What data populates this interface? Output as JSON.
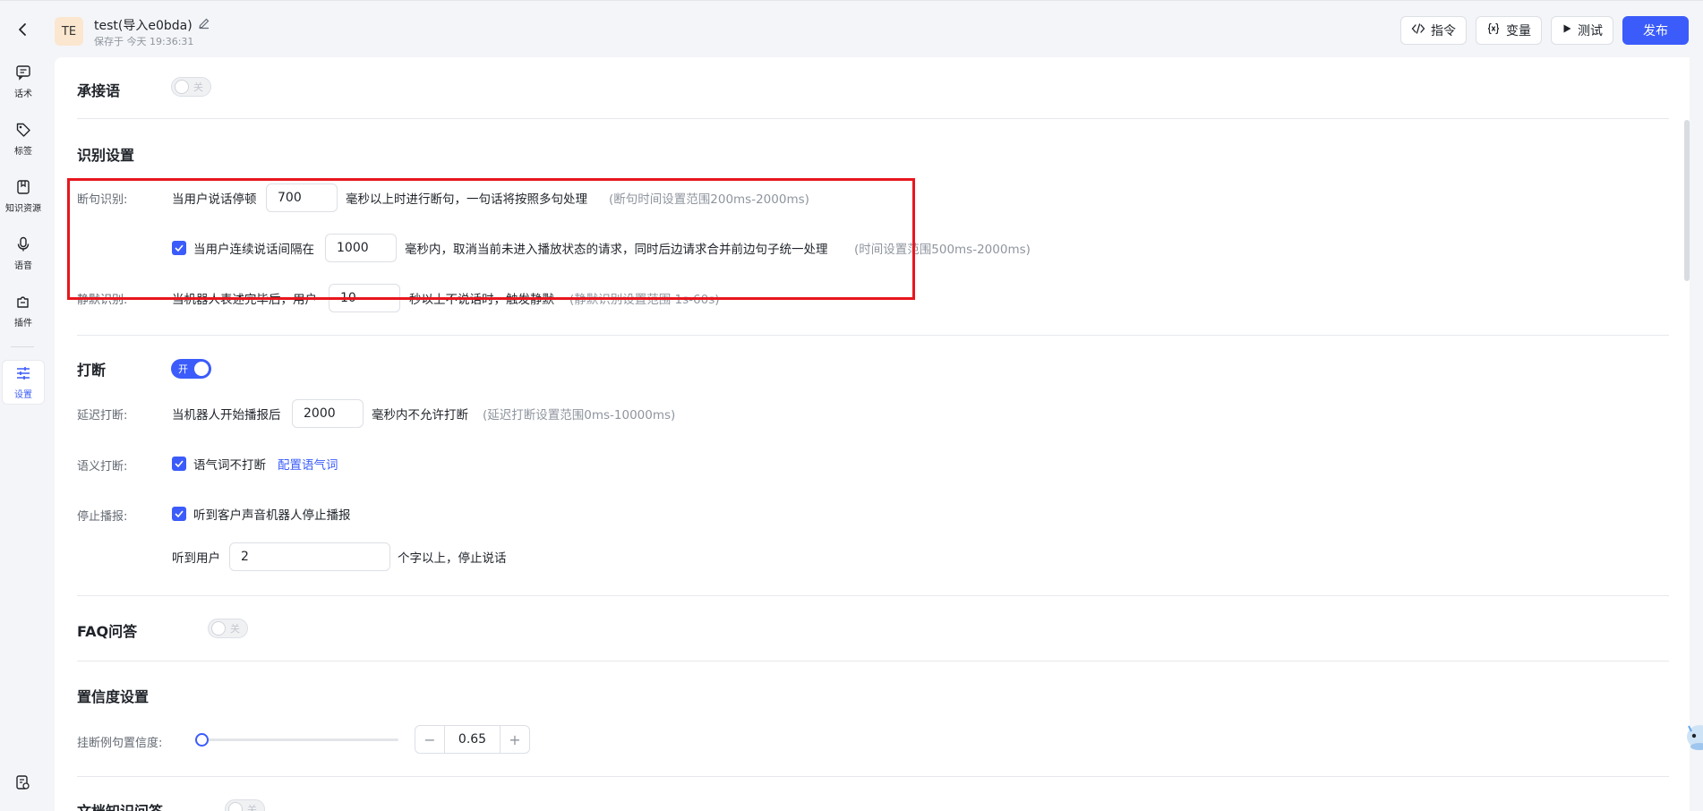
{
  "header": {
    "avatar_text": "TE",
    "title": "test(导入e0bda)",
    "saved_text": "保存于 今天 19:36:31",
    "actions": {
      "command": "指令",
      "variable": "变量",
      "test": "测试",
      "publish": "发布"
    }
  },
  "nav": {
    "items": [
      {
        "label": "话术",
        "icon": "chat-icon"
      },
      {
        "label": "标签",
        "icon": "tag-icon"
      },
      {
        "label": "知识资源",
        "icon": "book-icon"
      },
      {
        "label": "语音",
        "icon": "microphone-icon"
      },
      {
        "label": "插件",
        "icon": "plugin-icon"
      },
      {
        "label": "设置",
        "icon": "sliders-icon",
        "active": true
      }
    ]
  },
  "sections": {
    "transition": {
      "title": "承接语",
      "toggle": "关"
    },
    "recognition": {
      "title": "识别设置",
      "sentence_label": "断句识别:",
      "sentence_text_before": "当用户说话停顿",
      "sentence_value": "700",
      "sentence_text_after": "毫秒以上时进行断句，一句话将按照多句处理",
      "sentence_hint": "(断句时间设置范围200ms-2000ms)",
      "merge_text_before": "当用户连续说话间隔在",
      "merge_value": "1000",
      "merge_text_after": "毫秒内，取消当前未进入播放状态的请求，同时后边请求合并前边句子统一处理",
      "merge_hint": "(时间设置范围500ms-2000ms)",
      "silence_label": "静默识别:",
      "silence_text_before": "当机器人表述完毕后，用户",
      "silence_value": "10",
      "silence_text_after": "秒以上不说话时，触发静默",
      "silence_hint": "(静默识别设置范围 1s-60s)"
    },
    "interrupt": {
      "title": "打断",
      "toggle": "开",
      "delay_label": "延迟打断:",
      "delay_text_before": "当机器人开始播报后",
      "delay_value": "2000",
      "delay_text_after": "毫秒内不允许打断",
      "delay_hint": "(延迟打断设置范围0ms-10000ms)",
      "semantic_label": "语义打断:",
      "semantic_check_text": "语气词不打断",
      "semantic_link": "配置语气词",
      "stop_label": "停止播报:",
      "stop_check_text": "听到客户声音机器人停止播报",
      "stop_text_before": "听到用户",
      "stop_value": "2",
      "stop_text_after": "个字以上，停止说话"
    },
    "faq": {
      "title": "FAQ问答",
      "toggle": "关"
    },
    "confidence": {
      "title": "置信度设置",
      "hangup_label": "挂断例句置信度:",
      "value": "0.65",
      "minus": "−",
      "plus": "+",
      "slider_fraction": 0.0
    },
    "doc_qa": {
      "title": "文档知识问答",
      "toggle": "关"
    }
  },
  "colors": {
    "accent": "#3b5cfa",
    "highlight": "#e8161e"
  }
}
